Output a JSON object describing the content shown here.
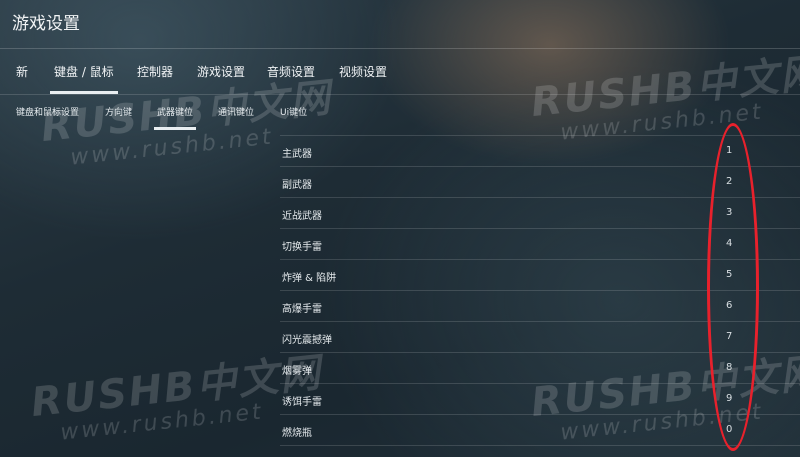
{
  "window": {
    "title": "游戏设置"
  },
  "tabs": [
    "新",
    "键盘 / 鼠标",
    "控制器",
    "游戏设置",
    "音频设置",
    "视频设置"
  ],
  "subtabs": [
    "键盘和鼠标设置",
    "方向键",
    "武器键位",
    "通讯键位",
    "Ui键位"
  ],
  "bindings": [
    {
      "action": "主武器",
      "key": "1"
    },
    {
      "action": "副武器",
      "key": "2"
    },
    {
      "action": "近战武器",
      "key": "3"
    },
    {
      "action": "切换手雷",
      "key": "4"
    },
    {
      "action": "炸弹 & 陷阱",
      "key": "5"
    },
    {
      "action": "高爆手雷",
      "key": "6"
    },
    {
      "action": "闪光震撼弹",
      "key": "7"
    },
    {
      "action": "烟雾弹",
      "key": "8"
    },
    {
      "action": "诱饵手雷",
      "key": "9"
    },
    {
      "action": "燃烧瓶",
      "key": "0"
    }
  ],
  "watermark": {
    "logo": "RUSHB中文网",
    "url": "www.rushb.net"
  },
  "colors": {
    "annotation": "#e8212c",
    "accent_underline": "#e9eef1"
  }
}
